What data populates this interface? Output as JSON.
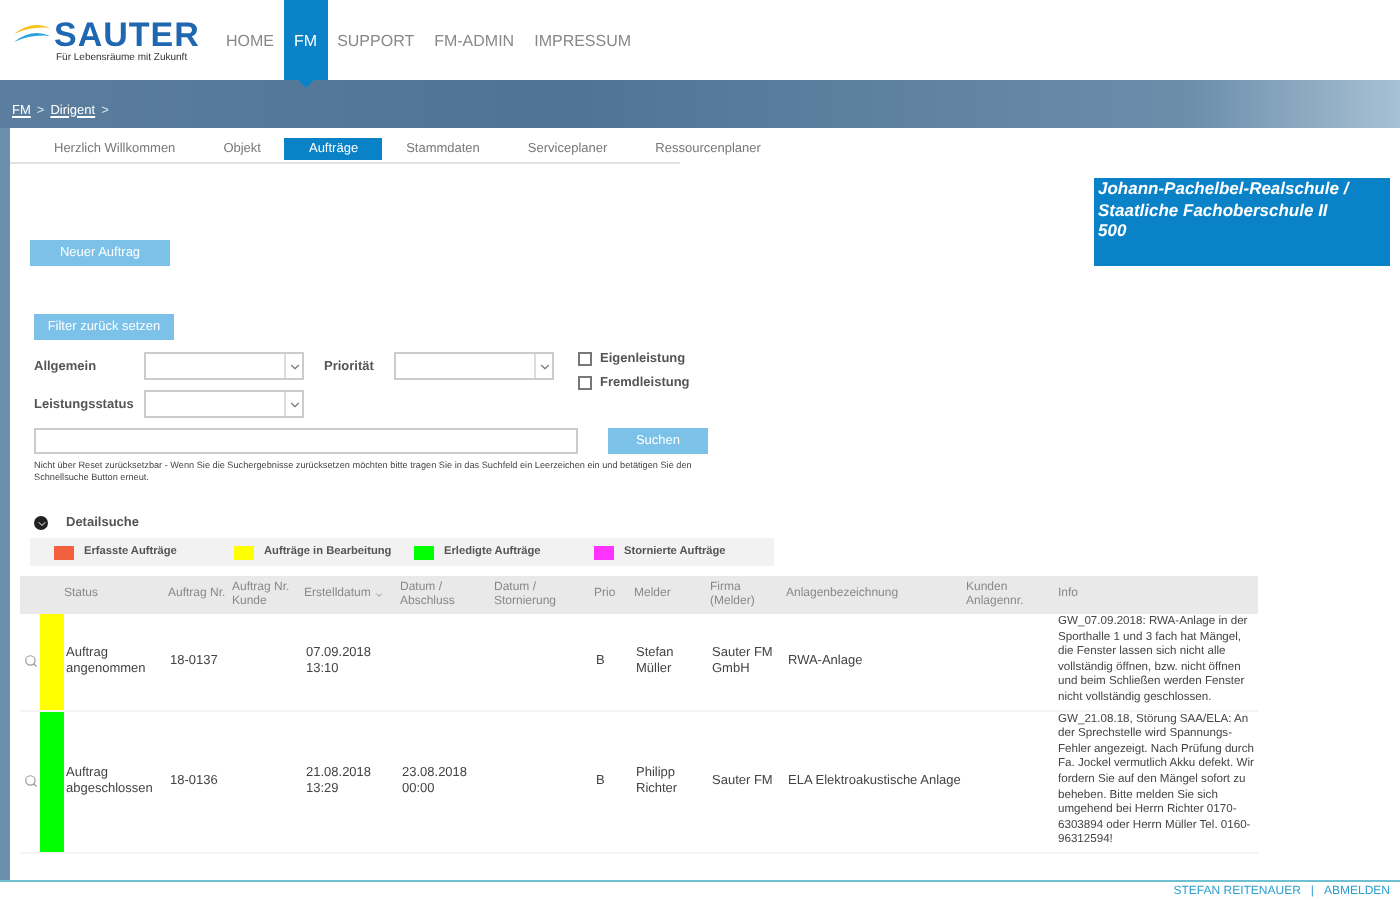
{
  "header": {
    "logo": {
      "name": "SAUTER",
      "tagline": "Für Lebensräume mit Zukunft"
    },
    "nav": [
      {
        "label": "HOME",
        "selected": false
      },
      {
        "label": "FM",
        "selected": true
      },
      {
        "label": "SUPPORT",
        "selected": false
      },
      {
        "label": "FM-ADMIN",
        "selected": false
      },
      {
        "label": "IMPRESSUM",
        "selected": false
      }
    ]
  },
  "breadcrumb": [
    {
      "label": "FM",
      "kind": "link"
    },
    {
      "label": ">",
      "kind": "separator"
    },
    {
      "label": "Dirigent",
      "kind": "link"
    },
    {
      "label": ">",
      "kind": "separator"
    }
  ],
  "tabs": [
    {
      "label": "Herzlich Willkommen",
      "selected": false
    },
    {
      "label": "Objekt",
      "selected": false
    },
    {
      "label": "Aufträge",
      "selected": true
    },
    {
      "label": "Stammdaten",
      "selected": false
    },
    {
      "label": "Serviceplaner",
      "selected": false
    },
    {
      "label": "Ressourcenplaner",
      "selected": false
    }
  ],
  "object_info": [
    "Johann-Pachelbel-Realschule /",
    "Staatliche Fachoberschule II",
    "500"
  ],
  "new_order_button": "Neuer Auftrag",
  "filter_reset_button": "Filter zurück setzen",
  "filters": {
    "allgemein": "Allgemein",
    "prioritaet": "Priorität",
    "leistungsstatus": "Leistungsstatus",
    "checkboxes": [
      {
        "label": "Eigenleistung",
        "checked": false
      },
      {
        "label": "Fremdleistung",
        "checked": false
      }
    ]
  },
  "search_button": "Suchen",
  "hint": "Nicht über Reset zurücksetzbar - Wenn Sie die Suchergebnisse zurücksetzen möchten bitte tragen Sie in das Suchfeld ein Leerzeichen ein und betätigen Sie den Schnellsuche Button erneut.",
  "detail_search": {
    "label": "Detailsuche",
    "expanded": false
  },
  "legend": [
    {
      "label": "Erfasste Aufträge",
      "color": "#f2603f"
    },
    {
      "label": "Aufträge in Bearbeitung",
      "color": "#ffff00"
    },
    {
      "label": "Erledigte Aufträge",
      "color": "#00ff00"
    },
    {
      "label": "Stornierte Aufträge",
      "color": "#ff33ff"
    }
  ],
  "table": {
    "columns": [
      "Status",
      "Auftrag Nr.",
      "Auftrag Nr. Kunde",
      "Erstelldatum",
      "Datum / Abschluss",
      "Datum / Stornierung",
      "Prio",
      "Melder",
      "Firma (Melder)",
      "Anlagenbezeichnung",
      "Kunden Anlagennr.",
      "Info"
    ],
    "rows": [
      {
        "color": "#ffff00",
        "cells": [
          "Auftrag angenommen",
          "18-0137",
          "",
          "07.09.2018 13:10",
          "",
          "",
          "B",
          "Stefan Müller",
          "Sauter FM GmbH",
          "RWA-Anlage",
          "",
          "GW_07.09.2018: RWA-Anlage in der Sporthalle 1 und 3 fach hat Mängel, die Fenster lassen sich nicht alle vollständig öffnen, bzw. nicht öffnen und beim Schließen werden Fenster nicht vollständig geschlossen."
        ]
      },
      {
        "color": "#00ff00",
        "cells": [
          "Auftrag abgeschlossen",
          "18-0136",
          "",
          "21.08.2018 13:29",
          "23.08.2018 00:00",
          "",
          "B",
          "Philipp Richter",
          "Sauter FM",
          "ELA Elektroakustische Anlage",
          "",
          "GW_21.08.18, Störung SAA/ELA: An der Sprechstelle wird Spannungs-Fehler angezeigt. Nach Prüfung durch Fa. Jockel vermutlich Akku defekt. Wir fordern Sie auf den Mängel sofort zu beheben. Bitte melden Sie sich umgehend bei Herrn Richter 0170-6303894 oder Herrn Müller Tel. 0160-96312594!"
        ]
      }
    ]
  },
  "footer": {
    "user": "STEFAN REITENAUER",
    "separator": "|",
    "logout": "ABMELDEN"
  }
}
